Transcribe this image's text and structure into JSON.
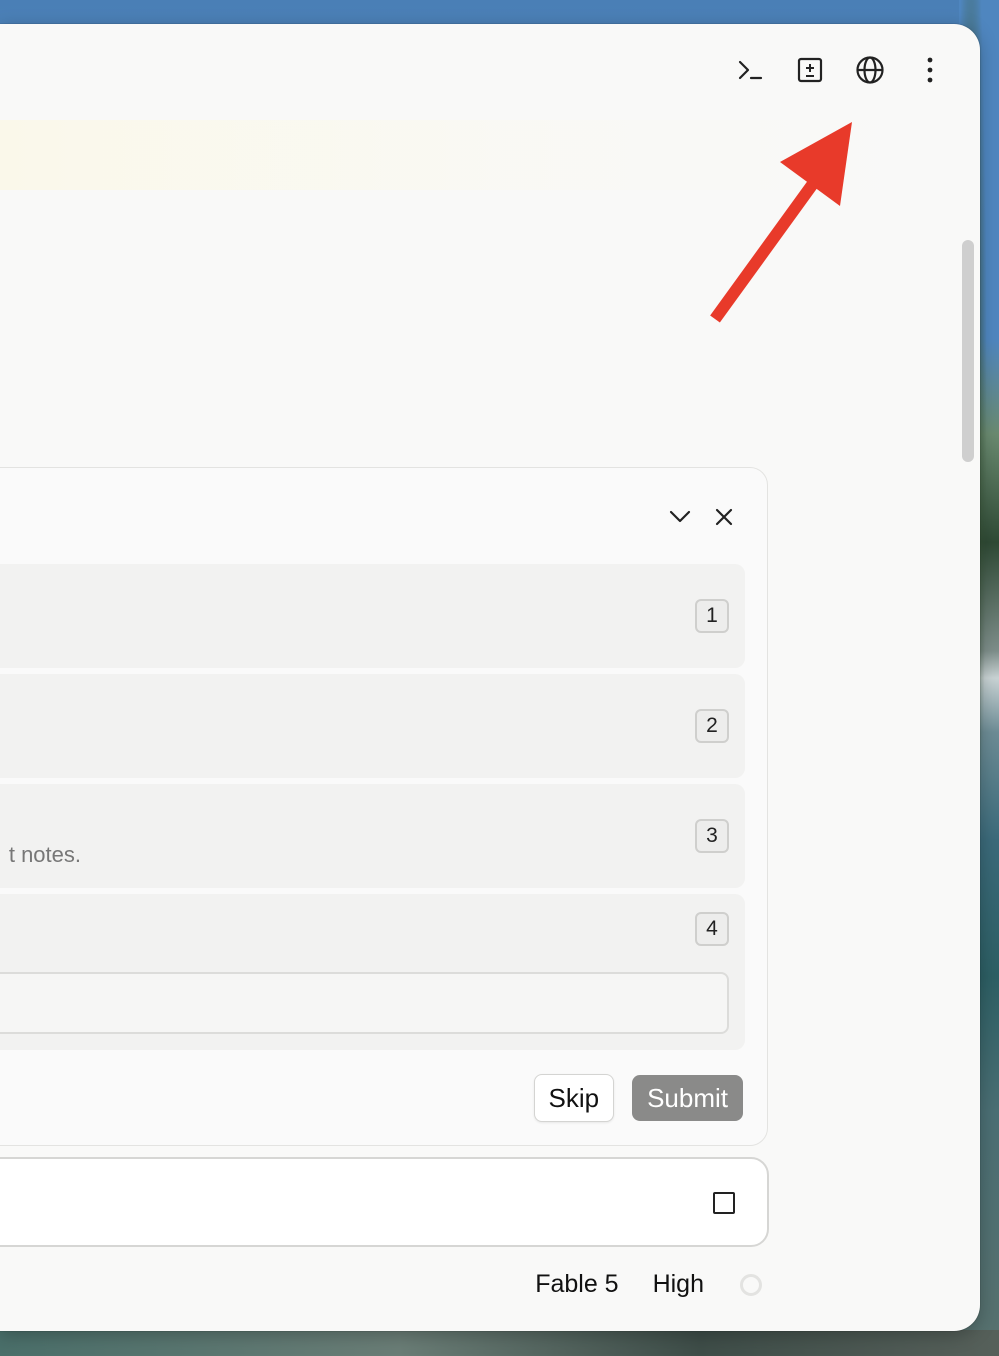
{
  "toolbar": {
    "icons": [
      "terminal-icon",
      "diff-icon",
      "globe-icon",
      "more-vertical-icon"
    ]
  },
  "question": {
    "controls": [
      "chevron-down-icon",
      "close-icon"
    ],
    "options": [
      {
        "key": "1"
      },
      {
        "key": "2"
      },
      {
        "key": "3",
        "note_visible": "t notes."
      },
      {
        "key": "4",
        "input_value": "",
        "input_placeholder": ""
      }
    ],
    "skip_label": "Skip",
    "submit_label": "Submit"
  },
  "composer": {
    "stop_icon": "stop-square-icon"
  },
  "status": {
    "model": "Fable 5",
    "effort": "High",
    "progress_icon": "progress-ring-icon"
  },
  "colors": {
    "window_bg": "#f9f9f8",
    "option_bg": "#f2f2f1",
    "submit_bg": "#8a8a89",
    "arrow": "#e83a2a"
  }
}
